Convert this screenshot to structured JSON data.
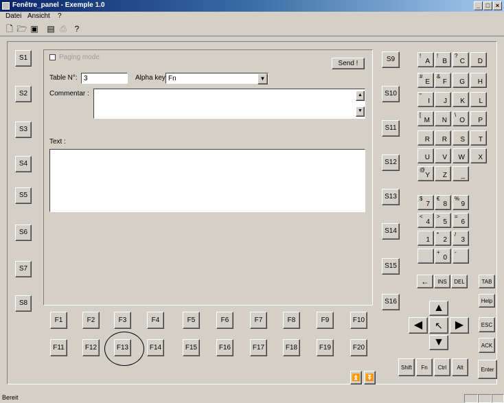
{
  "window": {
    "title": "Fenêtre_panel - Exemple 1.0"
  },
  "menu": {
    "items": [
      "Datei",
      "Ansicht",
      "?"
    ]
  },
  "toolbar": {
    "buttons": [
      "new",
      "open",
      "save",
      "panel",
      "print",
      "help"
    ]
  },
  "s_keys_left": [
    "S1",
    "S2",
    "S3",
    "S4",
    "S5",
    "S6",
    "S7",
    "S8"
  ],
  "s_keys_right": [
    "S9",
    "S10",
    "S11",
    "S12",
    "S13",
    "S14",
    "S15",
    "S16"
  ],
  "f_row1": [
    "F1",
    "F2",
    "F3",
    "F4",
    "F5",
    "F6",
    "F7",
    "F8",
    "F9",
    "F10"
  ],
  "f_row2": [
    "F11",
    "F12",
    "F13",
    "F14",
    "F15",
    "F16",
    "F17",
    "F18",
    "F19",
    "F20"
  ],
  "form": {
    "checkbox_label": "Paging mode",
    "send_label": "Send !",
    "table_label": "Table N°:",
    "table_value": "3",
    "alpha_label": "Alpha key:",
    "alpha_value": "Fn",
    "comment_label": "Commentar :",
    "text_label": "Text :"
  },
  "keypad": {
    "alpha": [
      {
        "top": "!",
        "bot": "A"
      },
      {
        "top": "!",
        "bot": "B"
      },
      {
        "top": "?",
        "bot": "C"
      },
      {
        "top": "",
        "bot": "D"
      },
      {
        "top": "#",
        "bot": "E"
      },
      {
        "top": "&",
        "bot": "F"
      },
      {
        "top": "",
        "bot": "G"
      },
      {
        "top": "",
        "bot": "H"
      },
      {
        "top": "\"",
        "bot": "I"
      },
      {
        "top": "",
        "bot": "J"
      },
      {
        "top": "",
        "bot": "K"
      },
      {
        "top": "",
        "bot": "L"
      },
      {
        "top": "[",
        "bot": "M"
      },
      {
        "top": "",
        "bot": "N"
      },
      {
        "top": "\\",
        "bot": "O"
      },
      {
        "top": "",
        "bot": "P"
      },
      {
        "top": "",
        "bot": "R"
      },
      {
        "top": "",
        "bot": "R"
      },
      {
        "top": "",
        "bot": "S"
      },
      {
        "top": "",
        "bot": "T"
      },
      {
        "top": "",
        "bot": "U"
      },
      {
        "top": "",
        "bot": "V"
      },
      {
        "top": "",
        "bot": "W"
      },
      {
        "top": "",
        "bot": "X"
      },
      {
        "top": "@",
        "bot": "Y"
      },
      {
        "top": "",
        "bot": "Z"
      },
      {
        "top": "",
        "bot": "_"
      }
    ],
    "numeric": [
      {
        "top": "$",
        "bot": "7"
      },
      {
        "top": "€",
        "bot": "8"
      },
      {
        "top": "%",
        "bot": "9"
      },
      {
        "top": "<",
        "bot": "4"
      },
      {
        "top": ">",
        "bot": "5"
      },
      {
        "top": "=",
        "bot": "6"
      },
      {
        "top": "",
        "bot": "1"
      },
      {
        "top": "*",
        "bot": "2"
      },
      {
        "top": "/",
        "bot": "3"
      },
      {
        "top": "",
        "bot": ""
      },
      {
        "top": "+",
        "bot": "0"
      },
      {
        "top": "-",
        "bot": ""
      }
    ],
    "backspace": "←",
    "ins": "INS",
    "del": "DEL",
    "tab": "TAB",
    "help": "Help",
    "esc": "ESC",
    "ack": "ACK",
    "shift": "Shift",
    "fn": "Fn",
    "ctrl": "Ctrl",
    "alt": "Alt",
    "enter": "Enter"
  },
  "status": {
    "text": "Bereit"
  }
}
